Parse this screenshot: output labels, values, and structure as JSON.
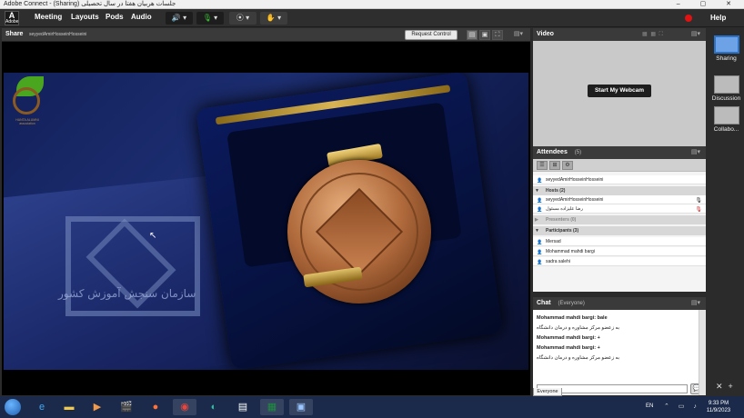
{
  "window": {
    "title": "Adobe Connect - (Sharing) جلسات هربیان هفتا در سال تحصیلی",
    "controls": "–  ▢  ✕"
  },
  "menubar": {
    "logo_text": "Adobe",
    "items": [
      "Meeting",
      "Layouts",
      "Pods",
      "Audio"
    ],
    "help": "Help",
    "icons": [
      "speaker-icon",
      "microphone-icon",
      "webcam-icon",
      "attendee-status-icon"
    ]
  },
  "share_pod": {
    "title": "Share",
    "owner": "seyyedAmirHosseinHosseini",
    "request_control": "Request Control",
    "book_text": "سازمان سنجش آموزش کشور",
    "org_text": "HANTA ALUMNI\nassociation"
  },
  "video_pod": {
    "title": "Video",
    "start_webcam": "Start My Webcam"
  },
  "attendees_pod": {
    "title": "Attendees",
    "count": "(5)",
    "current_user": "seyyedAmirHosseinHosseini",
    "hosts_header": "Hosts (2)",
    "hosts": [
      "seyyedAmirHosseinHosseini",
      "رضا علیزاده مسئول"
    ],
    "presenters_header": "Presenters (0)",
    "participants_header": "Participants (3)",
    "participants": [
      "Mersad",
      "Mohammad mahdi bargi",
      "sadra salehi"
    ]
  },
  "chat_pod": {
    "title": "Chat",
    "scope": "(Everyone)",
    "messages": [
      {
        "name": "Mohammad mahdi bargi: bale",
        "text": "به زعضو مرکز مشاوره و درمان دانشگاه"
      },
      {
        "name": "Mohammad mahdi bargi: +",
        "text": ""
      },
      {
        "name": "Mohammad mahdi bargi: +",
        "text": "به زعضو مرکز مشاوره و درمان دانشگاه"
      }
    ],
    "tab": "Everyone"
  },
  "layouts": [
    {
      "label": "Sharing",
      "active": true
    },
    {
      "label": "Discussion",
      "active": false
    },
    {
      "label": "Collabo...",
      "active": false
    }
  ],
  "taskbar": {
    "apps": [
      "windows-start",
      "internet-explorer-icon",
      "file-explorer-icon",
      "media-player-icon",
      "video-editor-icon",
      "firefox-icon",
      "chrome-icon",
      "edge-icon",
      "notepad-icon",
      "excel-icon",
      "adobe-connect-icon"
    ],
    "lang": "EN",
    "time": "9:33 PM",
    "date": "11/9/2023"
  },
  "colors": {
    "accent": "#2a73c8",
    "record": "#e01212",
    "pod_header": "#3a3a3a"
  }
}
